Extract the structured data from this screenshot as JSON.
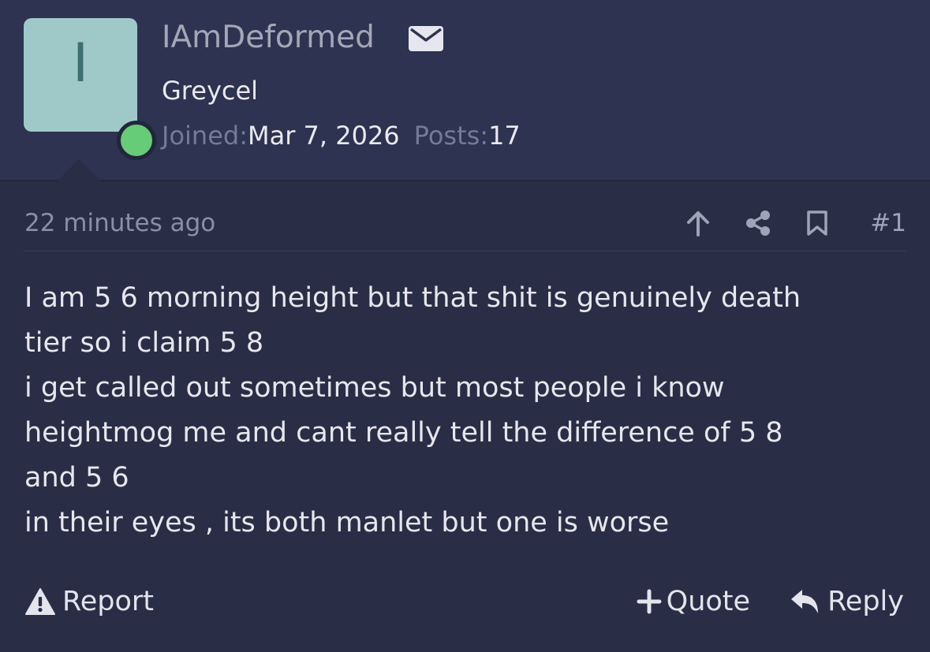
{
  "user": {
    "avatar_letter": "I",
    "username": "IAmDeformed",
    "title": "Greycel",
    "joined_label": "Joined:",
    "joined_value": "Mar 7, 2026",
    "posts_label": "Posts:",
    "posts_value": "17",
    "online_color": "#66cc77",
    "avatar_color": "#9fc9c9"
  },
  "icons": {
    "mail": "envelope-icon",
    "upvote": "arrow-up-icon",
    "share": "share-icon",
    "bookmark": "bookmark-icon",
    "report": "warning-triangle-icon",
    "quote": "plus-icon",
    "reply": "reply-arrow-icon"
  },
  "post": {
    "timestamp": "22 minutes ago",
    "number": "#1",
    "body_lines": [
      "I am 5 6 morning height but that shit is genuinely death",
      "tier so i claim 5 8",
      "i get called out sometimes but most people i know",
      "heightmog me and cant really tell the difference of 5 8",
      "and 5 6",
      "in their eyes , its both manlet but one is worse"
    ]
  },
  "actions": {
    "report": "Report",
    "quote": "Quote",
    "reply": "Reply"
  }
}
